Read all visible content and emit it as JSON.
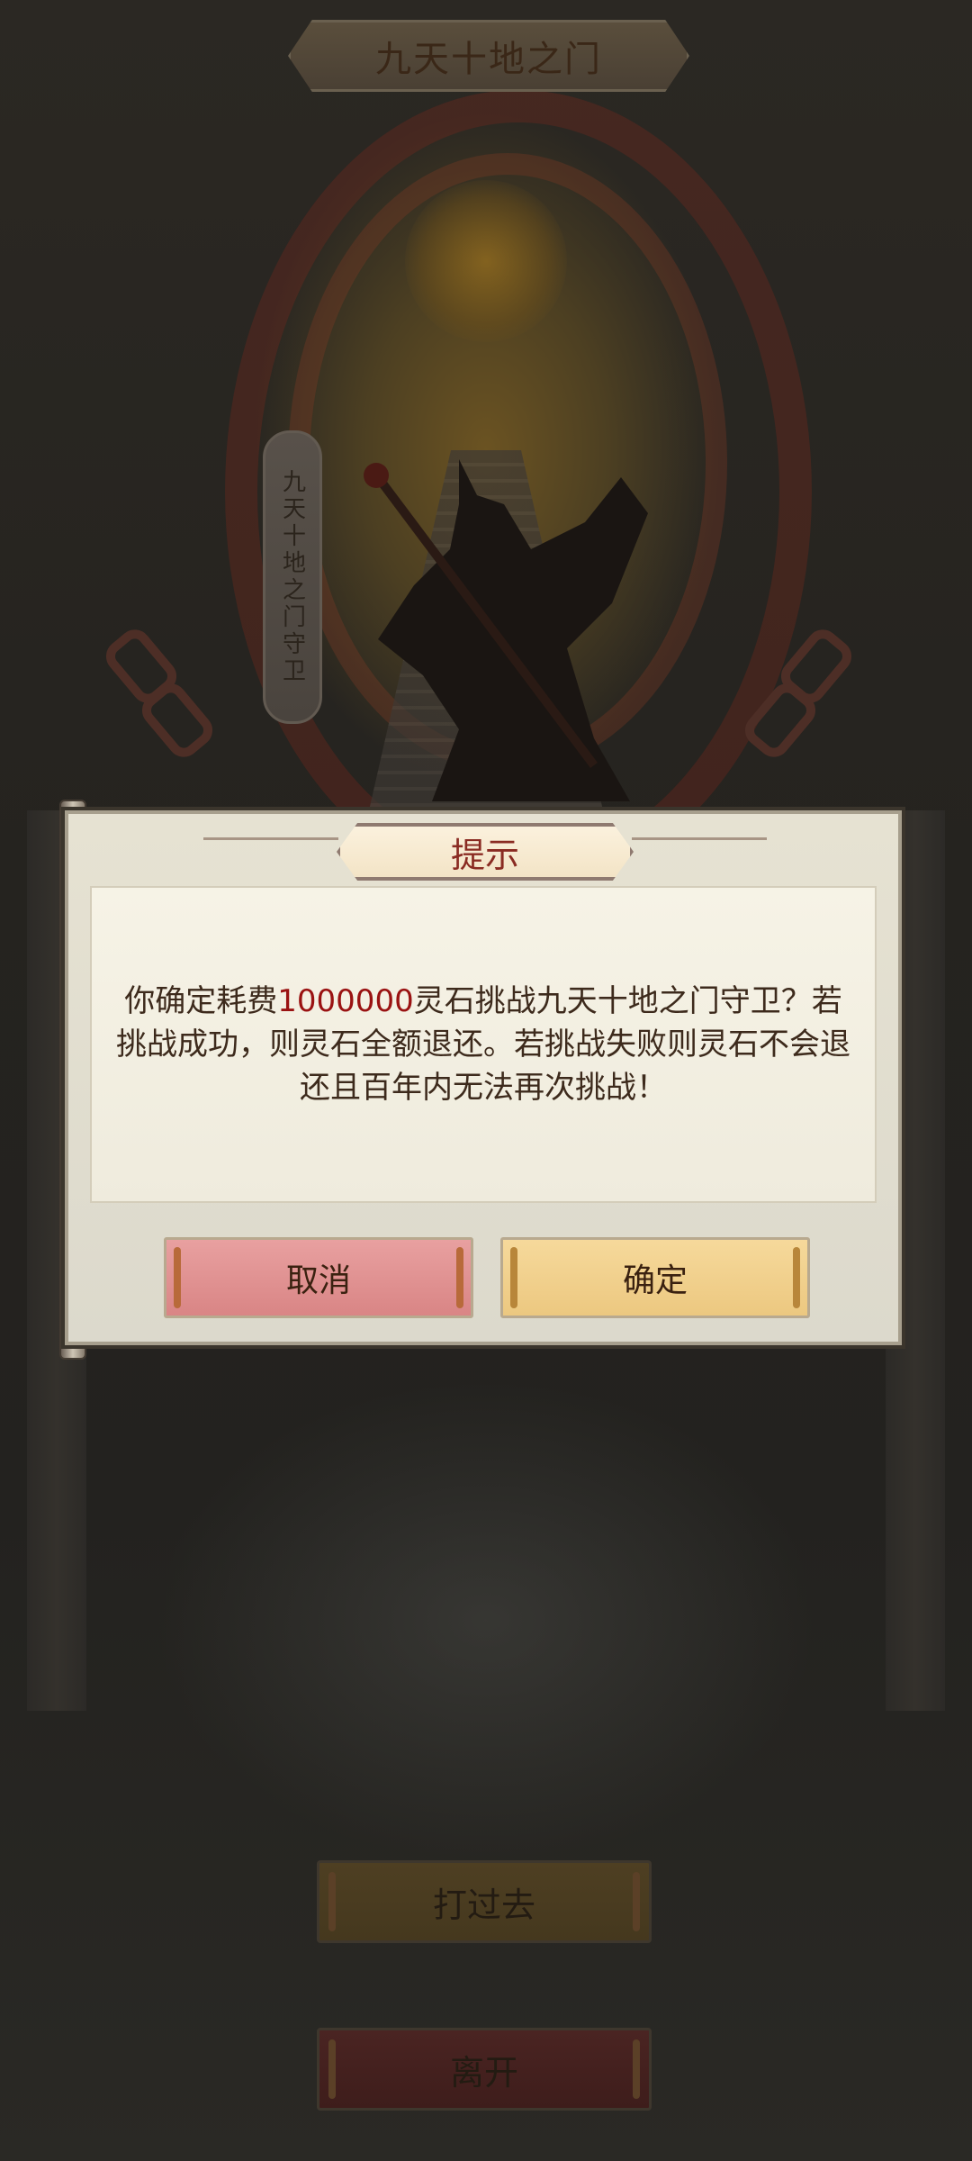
{
  "scene": {
    "title": "九天十地之门",
    "guard_banner": "九天十地之门守卫"
  },
  "bottom_buttons": {
    "fight": "打过去",
    "leave": "离开"
  },
  "dialog": {
    "title": "提示",
    "message_pre": "你确定耗费",
    "message_amount": "1000000",
    "message_post": "灵石挑战九天十地之门守卫？若挑战成功，则灵石全额退还。若挑战失败则灵石不会退还且百年内无法再次挑战！",
    "cancel_label": "取消",
    "confirm_label": "确定"
  },
  "colors": {
    "amount_highlight": "#9a1212",
    "cancel_button": "#d98585",
    "confirm_button": "#ecc880",
    "title_text": "#8a2b22"
  }
}
